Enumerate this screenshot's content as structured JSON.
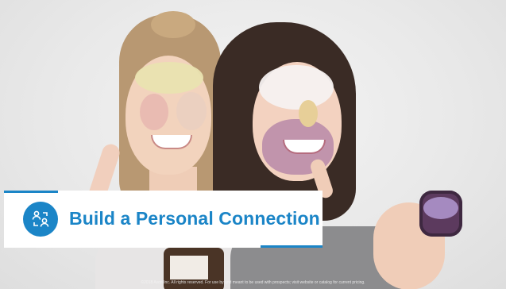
{
  "slide": {
    "title": "Build a Personal Connection",
    "icon": "people-connection-icon",
    "footer_text": "©2018 Avon Inc. All rights reserved. For use by and meant to be used with prospects; visit website or catalog for current pricing.",
    "colors": {
      "accent": "#1b85c7",
      "banner_background": "#ffffff",
      "slide_background": "#e9e9e9"
    }
  }
}
